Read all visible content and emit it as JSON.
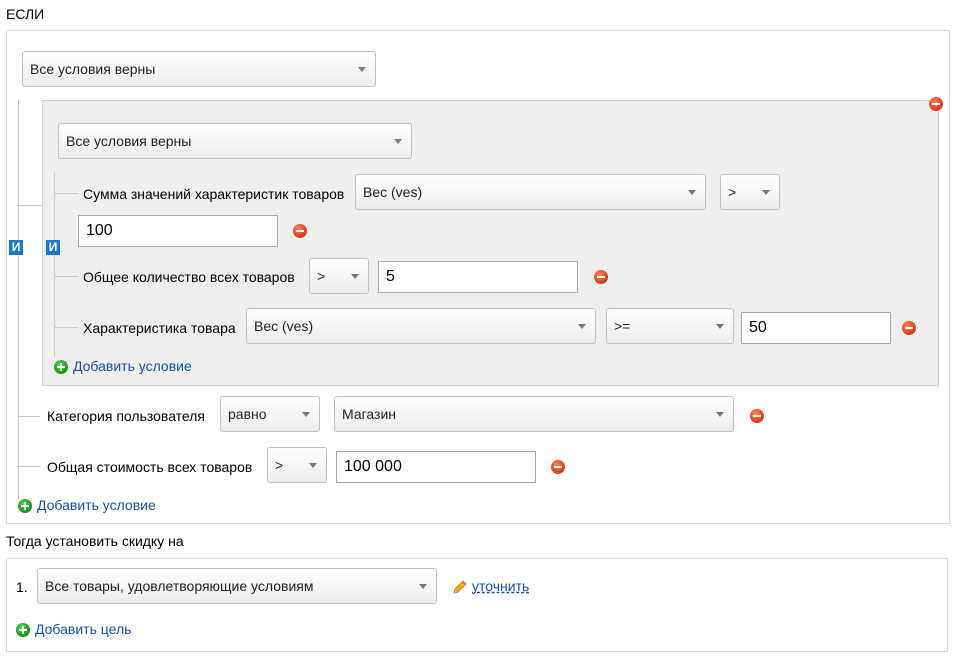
{
  "if_label": "ЕСЛИ",
  "outer": {
    "mode_select": "Все условия верны",
    "and_label": "И",
    "group": {
      "mode_select": "Все условия верны",
      "and_label": "И",
      "cond1": {
        "label": "Сумма значений характеристик товаров",
        "attribute": "Вес (ves)",
        "operator": ">",
        "value": "100"
      },
      "cond2": {
        "label": "Общее количество всех товаров",
        "operator": ">",
        "value": "5"
      },
      "cond3": {
        "label": "Характеристика товара",
        "attribute": "Вес (ves)",
        "operator": ">=",
        "value": "50"
      },
      "add_condition": "Добавить условие"
    },
    "cond_user": {
      "label": "Категория пользователя",
      "operator": "равно",
      "value": "Магазин"
    },
    "cond_total": {
      "label": "Общая стоимость всех товаров",
      "operator": ">",
      "value": "100 000"
    },
    "add_condition": "Добавить условие"
  },
  "then_label": "Тогда установить скидку на",
  "targets": {
    "item_number": "1.",
    "item_select": "Все товары, удовлетворяющие условиям",
    "refine_link": "уточнить",
    "add_target": "Добавить цель"
  },
  "colors": {
    "accent_blue": "#1d78c8",
    "link": "#1a4ea8",
    "remove_red": "#e0401a",
    "add_green": "#1b9c1b"
  }
}
